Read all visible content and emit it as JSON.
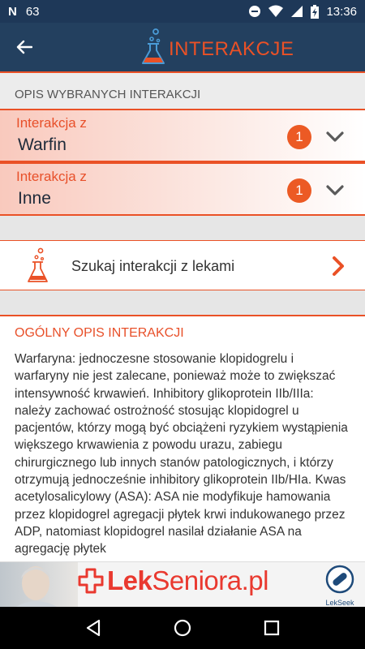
{
  "status_bar": {
    "notification_count": "63",
    "time": "13:36"
  },
  "app_bar": {
    "title": "INTERAKCJE",
    "accent_color": "#ea5126",
    "background_color": "#23405f"
  },
  "selected_section": {
    "header": "OPIS WYBRANYCH INTERAKCJI",
    "items": [
      {
        "label": "Interakcja z",
        "value": "Warfin",
        "count": "1"
      },
      {
        "label": "Interakcja z",
        "value": "Inne",
        "count": "1"
      }
    ]
  },
  "search": {
    "label": "Szukaj interakcji z lekami"
  },
  "general_description": {
    "title": "OGÓLNY OPIS INTERAKCJI",
    "text": "Warfaryna: jednoczesne stosowanie klopidogrelu i warfaryny nie jest zalecane, ponieważ może to zwiększać intensywność krwawień. Inhibitory glikoprotein IIb/IIIa: należy zachować ostrożność stosując klopidogrel u pacjentów, którzy mogą być obciążeni ryzykiem wystąpienia większego krwawienia z powodu urazu, zabiegu chirurgicznego lub innych stanów patologicznych, i którzy otrzymują jednocześnie inhibitory glikoprotein IIb/HIa. Kwas acetylosalicylowy (ASA): ASA nie modyfikuje hamowania przez klopidogrel agregacji płytek krwi indukowanego przez ADP, natomiast klopidogrel nasilał działanie ASA na agregację płytek"
  },
  "ad": {
    "brand_part1": "Lek",
    "brand_part2": "Seniora.pl",
    "seek_label": "LekSeek"
  },
  "icons": {
    "back": "arrow-left-icon",
    "flask": "flask-icon",
    "chevron_down": "chevron-down-icon",
    "chevron_right": "chevron-right-icon"
  }
}
